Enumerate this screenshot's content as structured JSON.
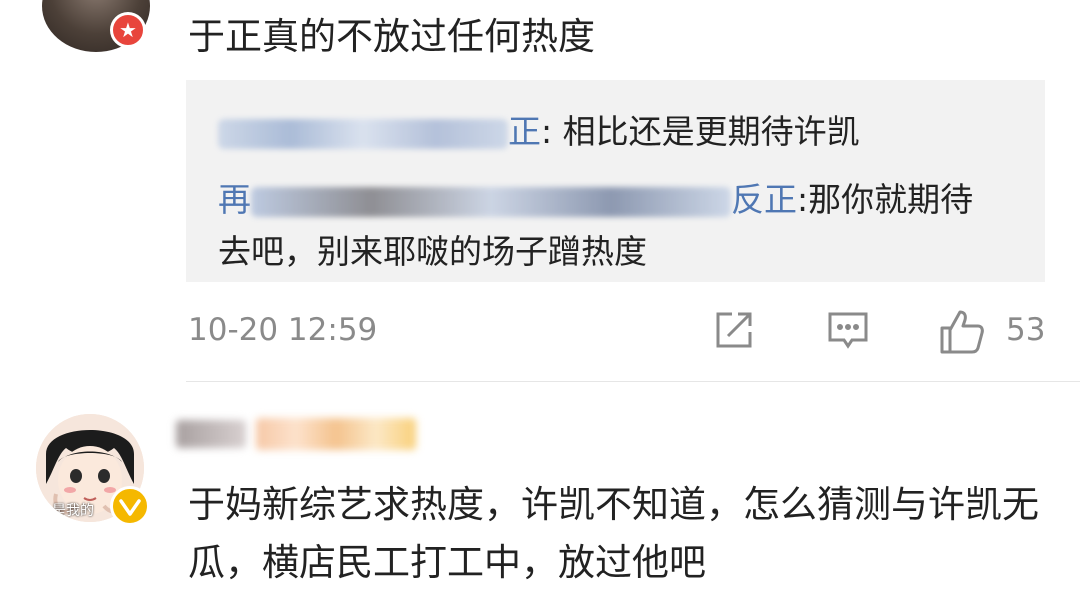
{
  "comment1": {
    "text": "于正真的不放过任何热度",
    "replies": [
      {
        "name_suffix": "正",
        "text": ": 相比还是更期待许凯"
      },
      {
        "name_prefix": "再",
        "name_suffix": "反正",
        "text_line1": ":那你就期待",
        "text_line2": "去吧，别来耶啵的场子蹭热度"
      }
    ],
    "timestamp": "10-20 12:59",
    "like_count": "53",
    "icons": [
      "share-icon",
      "comment-icon",
      "like-icon"
    ]
  },
  "comment2": {
    "avatar_caption": "是我的",
    "text": "于妈新综艺求热度，许凯不知道，怎么猜测与许凯无瓜，横店民工打工中，放过他吧"
  },
  "colors": {
    "link": "#4f77b3",
    "meta": "#8a8a8a",
    "badge_red": "#e8453c",
    "badge_gold": "#f5b800",
    "reply_bg": "#f2f2f2"
  }
}
